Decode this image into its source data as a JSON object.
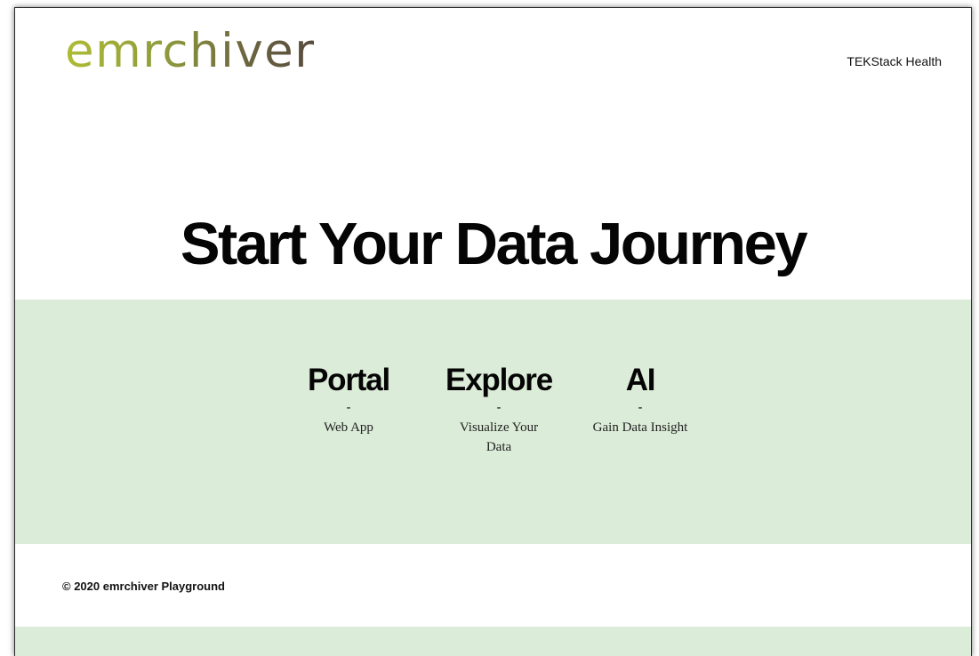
{
  "header": {
    "logo_text": "emrchiver",
    "company_link": "TEKStack Health"
  },
  "hero": {
    "title": "Start Your Data Journey"
  },
  "products": [
    {
      "title": "Portal",
      "separator": "-",
      "description": "Web App"
    },
    {
      "title": "Explore",
      "separator": "-",
      "description": "Visualize Your Data"
    },
    {
      "title": "AI",
      "separator": "-",
      "description": "Gain Data Insight"
    }
  ],
  "footer": {
    "copyright": "© 2020 emrchiver Playground"
  },
  "colors": {
    "band_background": "#dbecd8",
    "logo_gradient_start": "#aebc34",
    "logo_gradient_end": "#564a3e",
    "text": "#050505"
  }
}
